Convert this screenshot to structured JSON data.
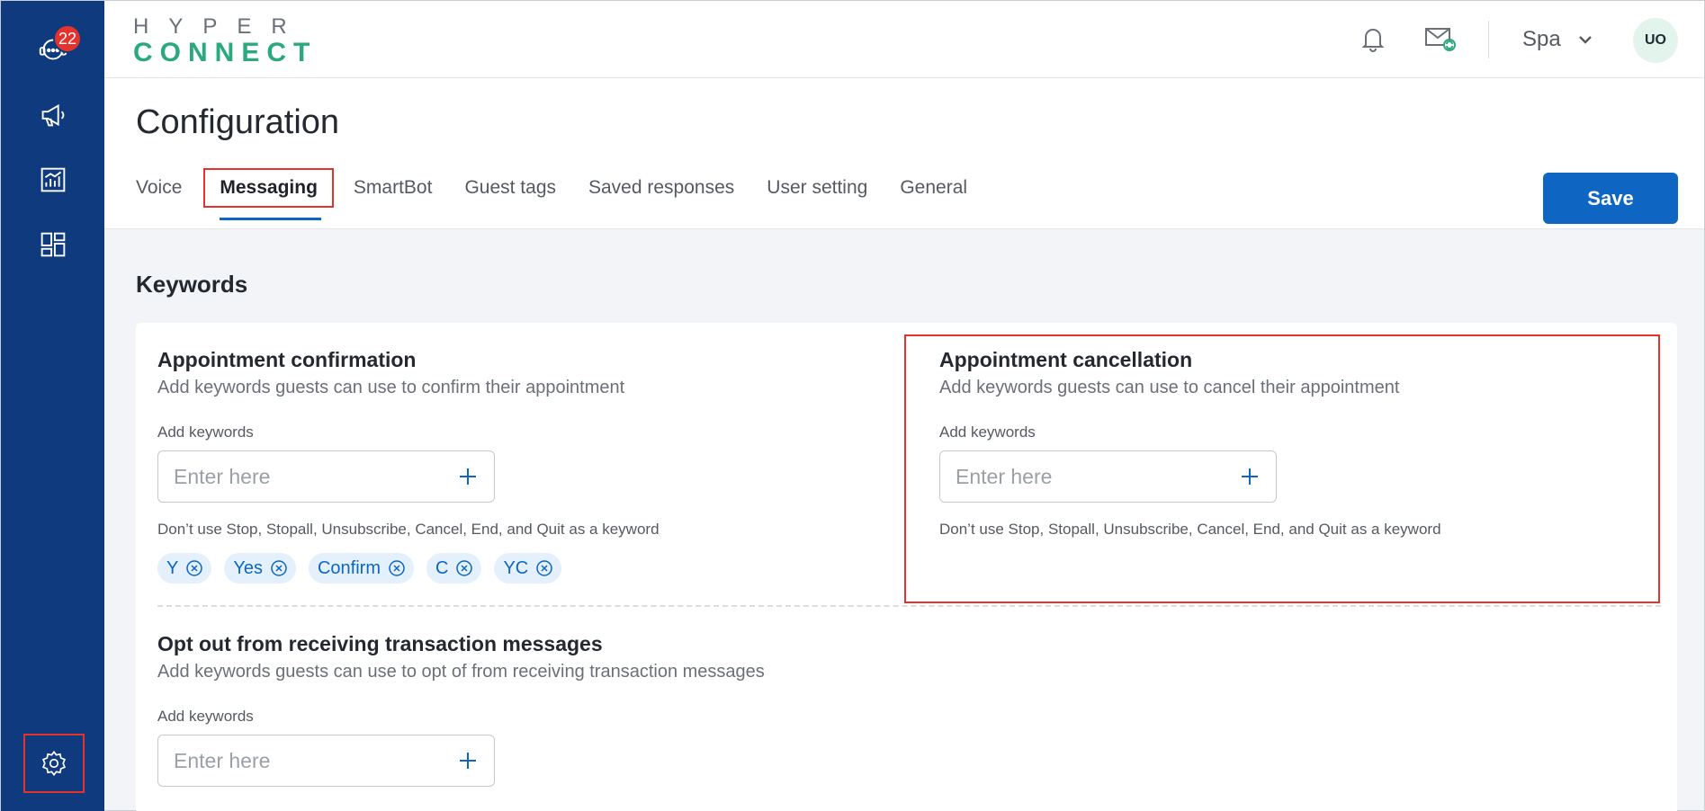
{
  "sidebar": {
    "support_badge": "22",
    "items": [
      {
        "name": "support-icon"
      },
      {
        "name": "megaphone-icon"
      },
      {
        "name": "reports-icon"
      },
      {
        "name": "dashboard-icon"
      }
    ],
    "settings_icon": "gear-icon"
  },
  "header": {
    "logo_top": "HYPER",
    "logo_bottom": "CONNECT",
    "workspace": "Spa",
    "avatar_initials": "UO"
  },
  "page": {
    "title": "Configuration",
    "tabs": [
      {
        "label": "Voice"
      },
      {
        "label": "Messaging",
        "active": true
      },
      {
        "label": "SmartBot"
      },
      {
        "label": "Guest tags"
      },
      {
        "label": "Saved responses"
      },
      {
        "label": "User setting"
      },
      {
        "label": "General"
      }
    ],
    "save_label": "Save"
  },
  "keywords": {
    "section_title": "Keywords",
    "confirmation": {
      "title": "Appointment confirmation",
      "description": "Add keywords guests can use to confirm their appointment",
      "label": "Add keywords",
      "placeholder": "Enter here",
      "hint": "Don’t use Stop, Stopall, Unsubscribe, Cancel, End, and Quit as a keyword",
      "chips": [
        "Y",
        "Yes",
        "Confirm",
        "C",
        "YC"
      ]
    },
    "cancellation": {
      "title": "Appointment cancellation",
      "description": "Add keywords guests can use to cancel their appointment",
      "label": "Add keywords",
      "placeholder": "Enter here",
      "hint": "Don’t use Stop, Stopall, Unsubscribe, Cancel, End, and Quit as a keyword"
    },
    "opt_out": {
      "title": "Opt out from receiving transaction messages",
      "description": "Add keywords guests can use to opt of from receiving transaction messages",
      "label": "Add keywords",
      "placeholder": "Enter here"
    }
  },
  "colors": {
    "sidebar": "#0f3a7d",
    "primary": "#0e66c2",
    "highlight": "#e5322d",
    "logo_green": "#2aa87e",
    "chip_bg": "#e4f0fb"
  }
}
